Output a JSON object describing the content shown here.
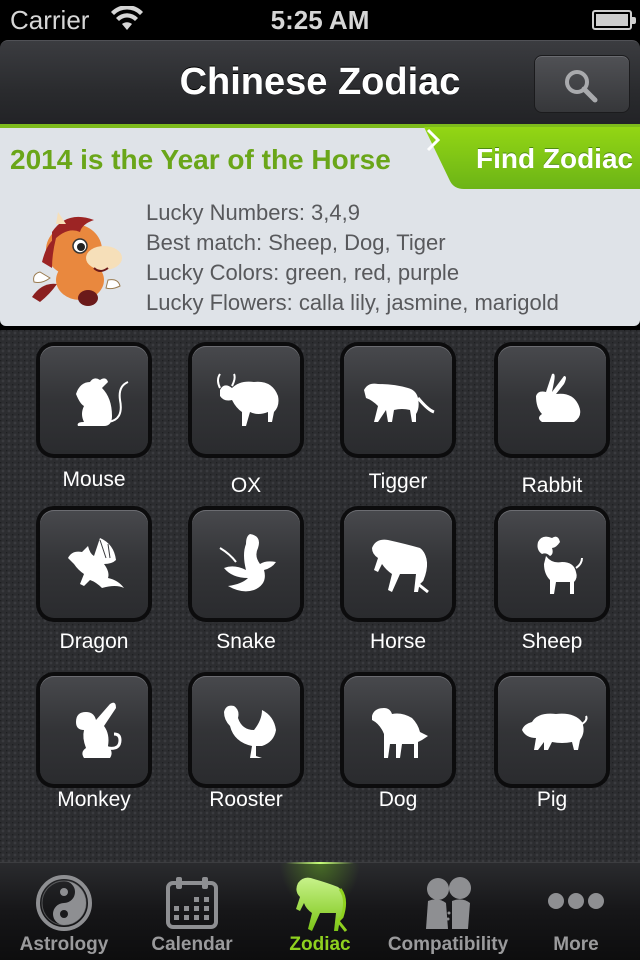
{
  "status_bar": {
    "carrier": "Carrier",
    "time": "5:25 AM",
    "wifi_icon": "wifi-icon",
    "battery_icon": "battery-full-icon"
  },
  "nav": {
    "title": "Chinese Zodiac",
    "search_icon": "search-icon"
  },
  "banner": {
    "title": "2014 is the Year of the Horse",
    "find_button": "Find Zodiac",
    "mascot": "horse-cartoon-mascot",
    "lucky": [
      "Lucky Numbers: 3,4,9",
      "Best match: Sheep, Dog, Tiger",
      "Lucky Colors: green, red, purple",
      "Lucky Flowers: calla lily, jasmine, marigold"
    ],
    "accent_color": "#7dbb1c"
  },
  "zodiac": [
    {
      "label": "Mouse",
      "icon": "mouse-icon"
    },
    {
      "label": "OX",
      "icon": "ox-icon"
    },
    {
      "label": "Tigger",
      "icon": "tiger-icon"
    },
    {
      "label": "Rabbit",
      "icon": "rabbit-icon"
    },
    {
      "label": "Dragon",
      "icon": "dragon-icon"
    },
    {
      "label": "Snake",
      "icon": "snake-icon"
    },
    {
      "label": "Horse",
      "icon": "horse-icon"
    },
    {
      "label": "Sheep",
      "icon": "sheep-icon"
    },
    {
      "label": "Monkey",
      "icon": "monkey-icon"
    },
    {
      "label": "Rooster",
      "icon": "rooster-icon"
    },
    {
      "label": "Dog",
      "icon": "dog-icon"
    },
    {
      "label": "Pig",
      "icon": "pig-icon"
    }
  ],
  "tabs": [
    {
      "label": "Astrology",
      "icon": "yin-yang-icon",
      "active": false
    },
    {
      "label": "Calendar",
      "icon": "calendar-icon",
      "active": false
    },
    {
      "label": "Zodiac",
      "icon": "horse-icon",
      "active": true
    },
    {
      "label": "Compatibility",
      "icon": "kissing-couple-icon",
      "active": false
    },
    {
      "label": "More",
      "icon": "more-dots-icon",
      "active": false
    }
  ],
  "colors": {
    "active_tab": "#8fd11f",
    "inactive_tab": "#9a9a9c",
    "banner_title": "#6aa619"
  }
}
